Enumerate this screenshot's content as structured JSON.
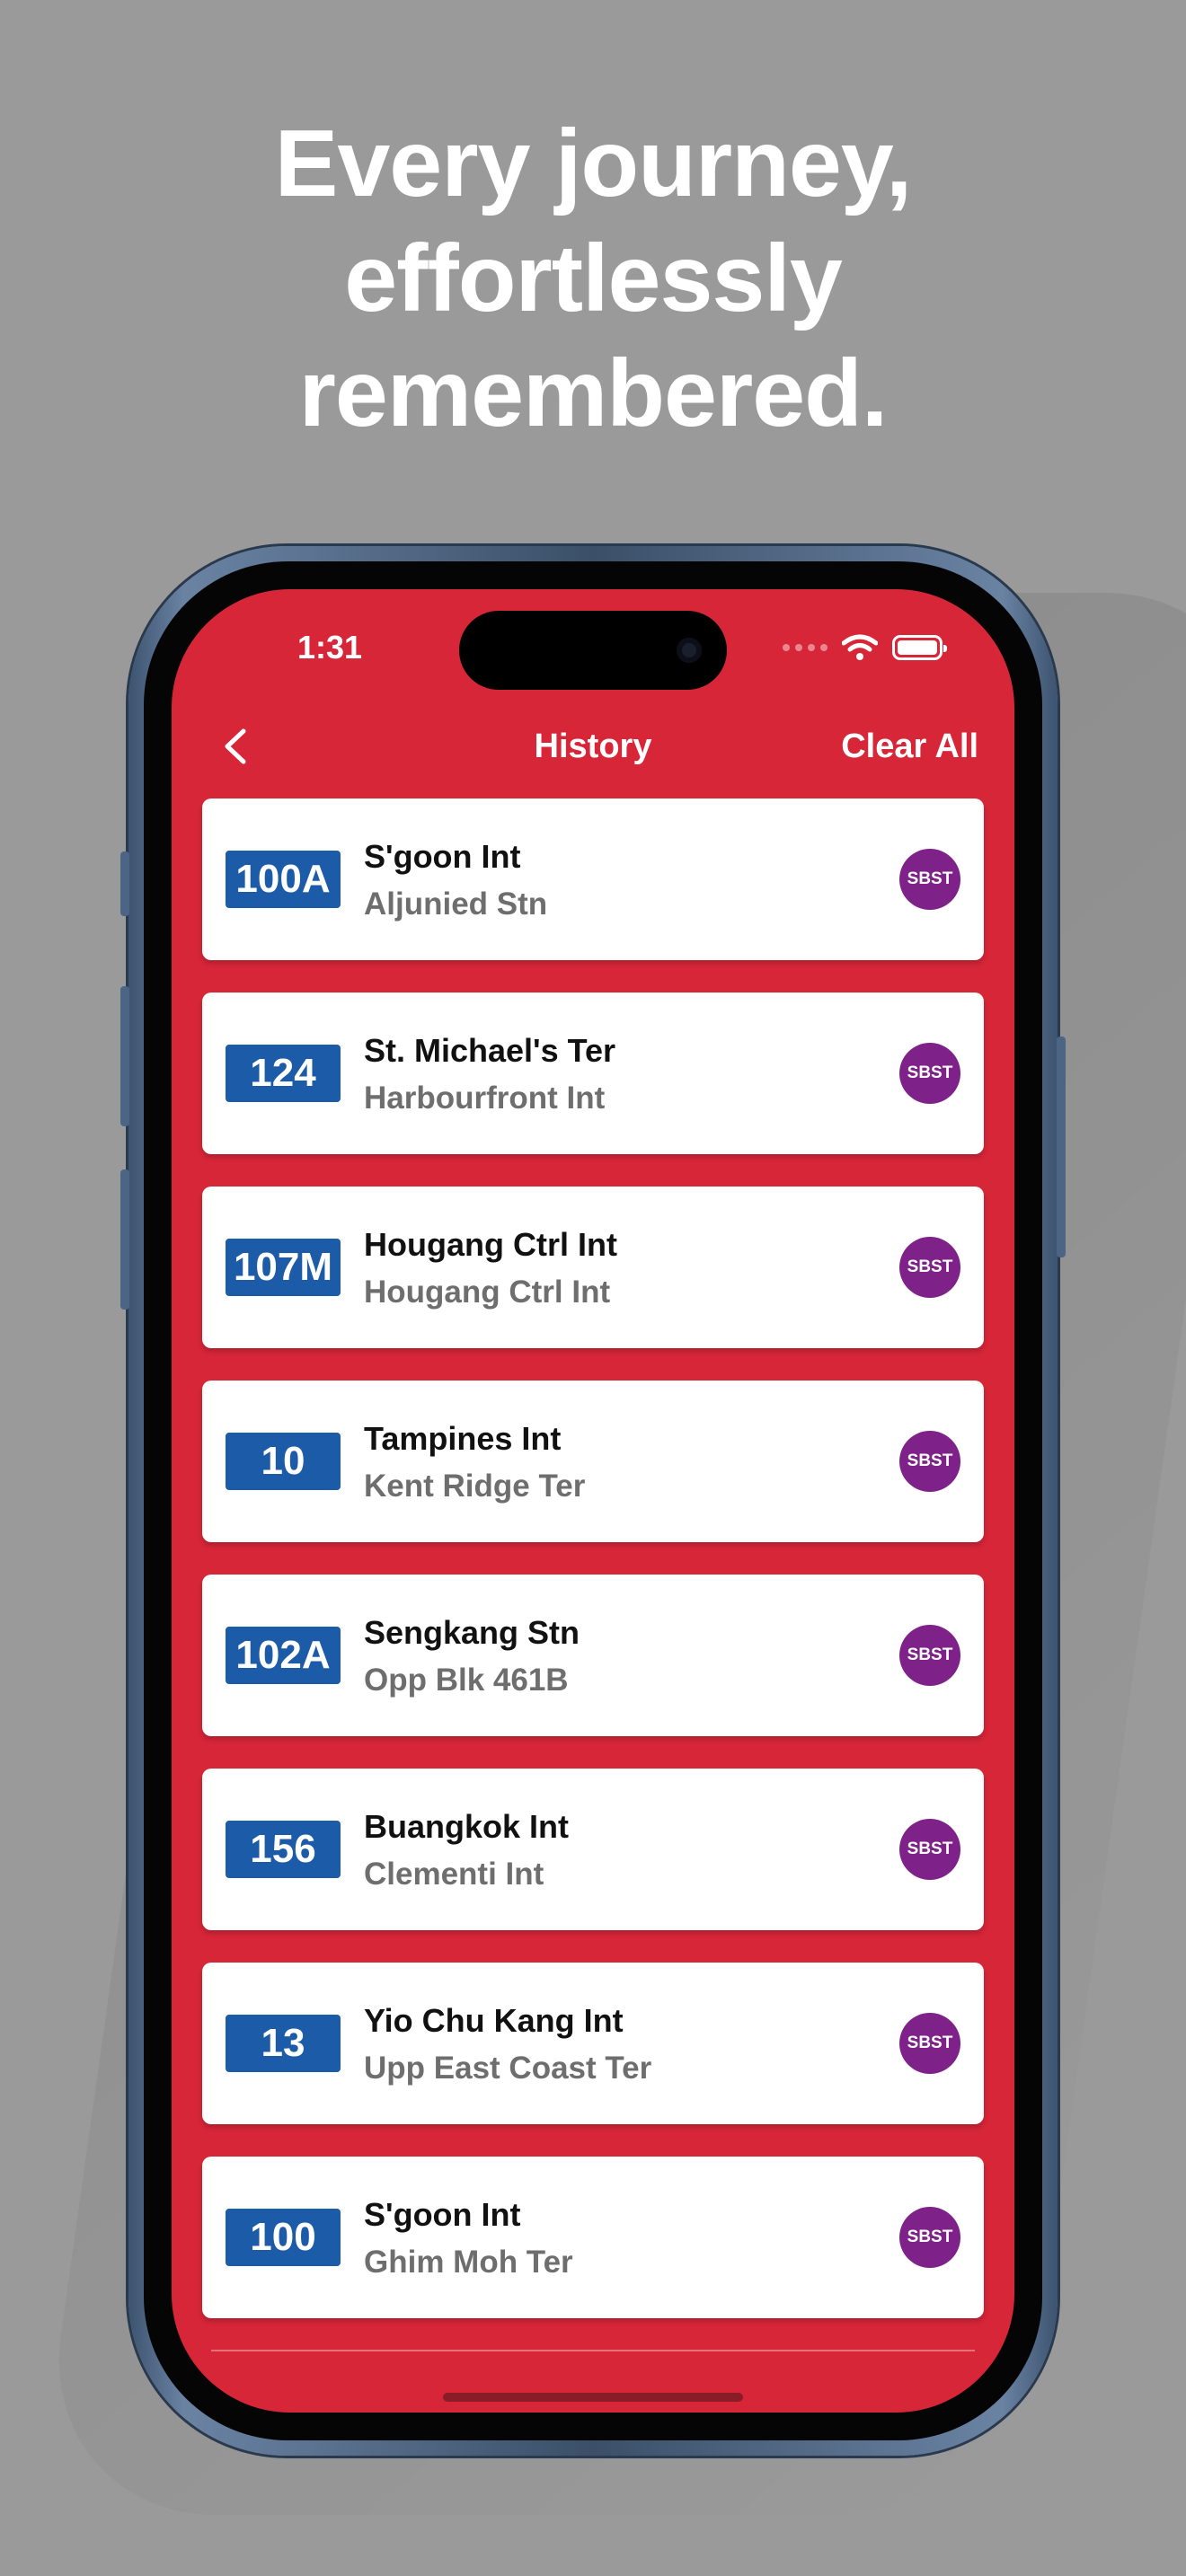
{
  "headline": [
    "Every journey,",
    "effortlessly",
    "remembered."
  ],
  "status_bar": {
    "time": "1:31"
  },
  "navbar": {
    "title": "History",
    "clear_label": "Clear All"
  },
  "history": [
    {
      "route": "100A",
      "destination": "S'goon Int",
      "origin": "Aljunied Stn",
      "operator": "SBST"
    },
    {
      "route": "124",
      "destination": "St. Michael's Ter",
      "origin": "Harbourfront Int",
      "operator": "SBST"
    },
    {
      "route": "107M",
      "destination": "Hougang Ctrl Int",
      "origin": "Hougang Ctrl Int",
      "operator": "SBST"
    },
    {
      "route": "10",
      "destination": "Tampines Int",
      "origin": "Kent Ridge Ter",
      "operator": "SBST"
    },
    {
      "route": "102A",
      "destination": "Sengkang Stn",
      "origin": "Opp Blk 461B",
      "operator": "SBST"
    },
    {
      "route": "156",
      "destination": "Buangkok Int",
      "origin": "Clementi Int",
      "operator": "SBST"
    },
    {
      "route": "13",
      "destination": "Yio Chu Kang Int",
      "origin": "Upp East Coast Ter",
      "operator": "SBST"
    },
    {
      "route": "100",
      "destination": "S'goon Int",
      "origin": "Ghim Moh Ter",
      "operator": "SBST"
    }
  ],
  "colors": {
    "background": "#9a9a9a",
    "app_accent": "#d72638",
    "route_badge": "#1c5ba7",
    "operator_badge": "#7e2188"
  },
  "icons": [
    "back-chevron-icon",
    "wifi-icon",
    "battery-icon",
    "signal-icon"
  ]
}
